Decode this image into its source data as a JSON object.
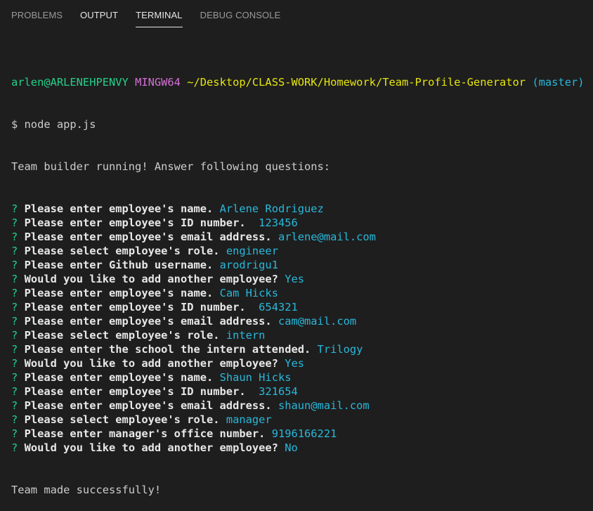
{
  "panel": {
    "tabs": [
      {
        "label": "PROBLEMS"
      },
      {
        "label": "OUTPUT"
      },
      {
        "label": "TERMINAL"
      },
      {
        "label": "DEBUG CONSOLE"
      }
    ]
  },
  "terminal": {
    "prompt": {
      "user": "arlen@ARLENEHPENVY",
      "shell": "MINGW64",
      "path": "~/Desktop/CLASS-WORK/Homework/Team-Profile-Generator",
      "branch": "(master)"
    },
    "command": "$ node app.js",
    "intro": "Team builder running! Answer following questions:",
    "qa": [
      {
        "mark": "?",
        "q": "Please enter employee's name.",
        "a": "Arlene Rodriguez"
      },
      {
        "mark": "?",
        "q": "Please enter employee's ID number.",
        "a": " 123456"
      },
      {
        "mark": "?",
        "q": "Please enter employee's email address.",
        "a": "arlene@mail.com"
      },
      {
        "mark": "?",
        "q": "Please select employee's role.",
        "a": "engineer"
      },
      {
        "mark": "?",
        "q": "Please enter Github username.",
        "a": "arodrigu1"
      },
      {
        "mark": "?",
        "q": "Would you like to add another employee?",
        "a": "Yes"
      },
      {
        "mark": "?",
        "q": "Please enter employee's name.",
        "a": "Cam Hicks"
      },
      {
        "mark": "?",
        "q": "Please enter employee's ID number.",
        "a": " 654321"
      },
      {
        "mark": "?",
        "q": "Please enter employee's email address.",
        "a": "cam@mail.com"
      },
      {
        "mark": "?",
        "q": "Please select employee's role.",
        "a": "intern"
      },
      {
        "mark": "?",
        "q": "Please enter the school the intern attended.",
        "a": "Trilogy"
      },
      {
        "mark": "?",
        "q": "Would you like to add another employee?",
        "a": "Yes"
      },
      {
        "mark": "?",
        "q": "Please enter employee's name.",
        "a": "Shaun Hicks"
      },
      {
        "mark": "?",
        "q": "Please enter employee's ID number.",
        "a": " 321654"
      },
      {
        "mark": "?",
        "q": "Please enter employee's email address.",
        "a": "shaun@mail.com"
      },
      {
        "mark": "?",
        "q": "Please select employee's role.",
        "a": "manager"
      },
      {
        "mark": "?",
        "q": "Please enter manager's office number.",
        "a": "9196166221"
      },
      {
        "mark": "?",
        "q": "Would you like to add another employee?",
        "a": "No"
      }
    ],
    "final": "Team made successfully!"
  }
}
